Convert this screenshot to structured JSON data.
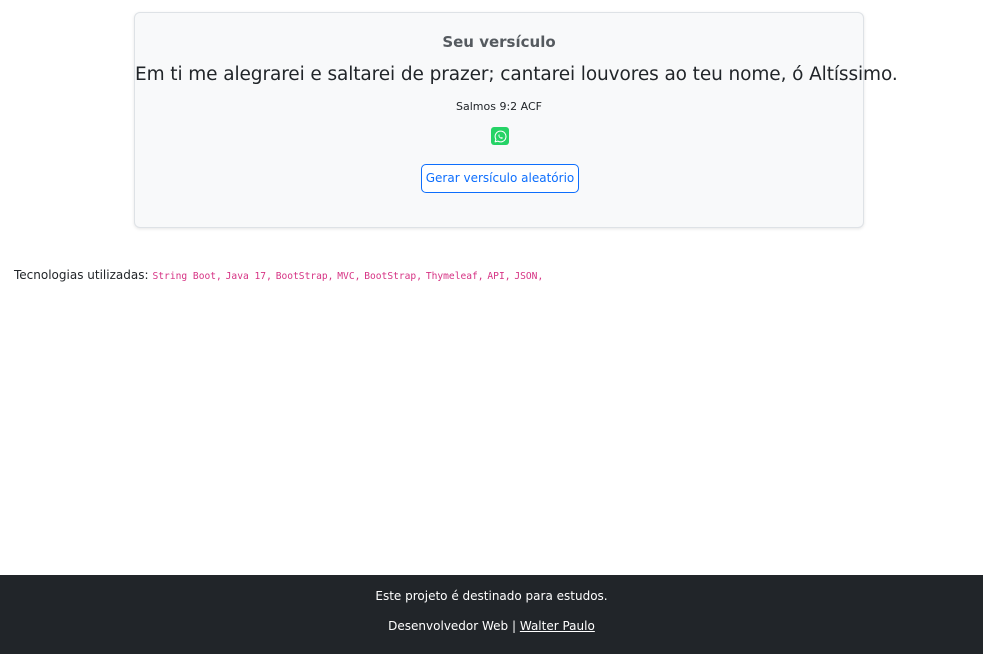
{
  "card": {
    "title": "Seu versículo",
    "verse_text": "Em ti me alegrarei e saltarei de prazer; cantarei louvores ao teu nome, ó Altíssimo.",
    "reference": "Salmos 9:2 ACF",
    "share_icon": "whatsapp-icon",
    "random_button_label": "Gerar versículo aleatório"
  },
  "technologies": {
    "label": "Tecnologias utilizadas:",
    "items": [
      "String Boot,",
      "Java 17,",
      "BootStrap,",
      "MVC,",
      "BootStrap,",
      "Thymeleaf,",
      "API,",
      "JSON,"
    ]
  },
  "footer": {
    "note": "Este projeto é destinado para estudos.",
    "credit_prefix": "Desenvolvedor Web |",
    "author_link": "Walter Paulo"
  },
  "colors": {
    "card_background": "#f8f9fa",
    "accent_blue": "#0d6efd",
    "whatsapp_green": "#25d366",
    "code_pink": "#d63384",
    "footer_background": "#212529"
  }
}
